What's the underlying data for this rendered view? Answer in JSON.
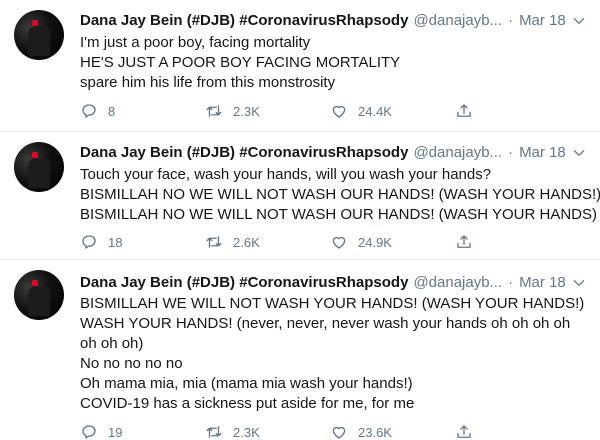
{
  "tweets": [
    {
      "author_name": "Dana Jay Bein (#DJB) #CoronavirusRhapsody",
      "handle": "@danajayb...",
      "separator": "·",
      "date": "Mar 18",
      "lines": [
        "I'm just a poor boy, facing mortality",
        "HE'S JUST A POOR BOY FACING MORTALITY",
        "spare him his life from this monstrosity"
      ],
      "replies": "8",
      "retweets": "2.3K",
      "likes": "24.4K"
    },
    {
      "author_name": "Dana Jay Bein (#DJB) #CoronavirusRhapsody",
      "handle": "@danajayb...",
      "separator": "·",
      "date": "Mar 18",
      "lines": [
        "Touch your face, wash your hands, will you wash your hands?",
        "BISMILLAH NO WE WILL NOT WASH OUR HANDS! (WASH YOUR HANDS!)",
        "BISMILLAH NO WE WILL NOT WASH  OUR HANDS! (WASH YOUR HANDS)"
      ],
      "replies": "18",
      "retweets": "2.6K",
      "likes": "24.9K"
    },
    {
      "author_name": "Dana Jay Bein (#DJB) #CoronavirusRhapsody",
      "handle": "@danajayb...",
      "separator": "·",
      "date": "Mar 18",
      "lines": [
        "BISMILLAH WE WILL NOT WASH YOUR HANDS! (WASH YOUR HANDS!)",
        "WASH YOUR HANDS! (never, never, never wash your hands oh oh oh oh oh oh oh)",
        "No no no no no",
        "Oh mama mia, mia (mama mia wash your hands!)",
        "COVID-19 has a sickness put aside for me, for me"
      ],
      "replies": "19",
      "retweets": "2.3K",
      "likes": "23.6K"
    }
  ],
  "icons": {
    "reply": "reply-icon",
    "retweet": "retweet-icon",
    "like": "heart-icon",
    "share": "share-icon",
    "more": "chevron-down-icon"
  },
  "colors": {
    "text": "#14171a",
    "secondary": "#657786",
    "divider": "#e6ecf0"
  }
}
